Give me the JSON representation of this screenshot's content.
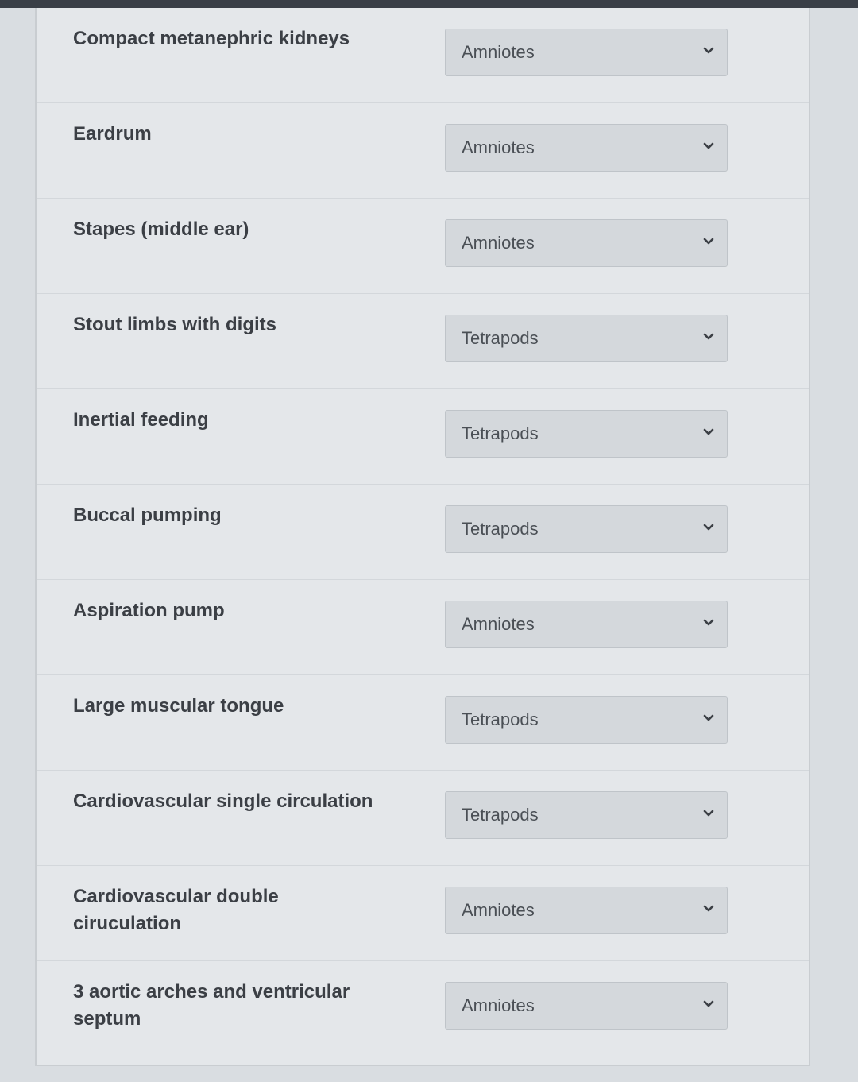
{
  "items": [
    {
      "label": "Compact metanephric kidneys",
      "selected": "Amniotes"
    },
    {
      "label": "Eardrum",
      "selected": "Amniotes"
    },
    {
      "label": "Stapes (middle ear)",
      "selected": "Amniotes"
    },
    {
      "label": "Stout limbs with digits",
      "selected": "Tetrapods"
    },
    {
      "label": "Inertial feeding",
      "selected": "Tetrapods"
    },
    {
      "label": "Buccal pumping",
      "selected": "Tetrapods"
    },
    {
      "label": "Aspiration pump",
      "selected": "Amniotes"
    },
    {
      "label": "Large muscular tongue",
      "selected": "Tetrapods"
    },
    {
      "label": "Cardiovascular single circulation",
      "selected": "Tetrapods"
    },
    {
      "label": "Cardiovascular double ciruculation",
      "selected": "Amniotes"
    },
    {
      "label": "3 aortic arches and ventricular septum",
      "selected": "Amniotes"
    }
  ],
  "icons": {
    "dropdown": "chevron-down-icon"
  },
  "colors": {
    "panel": "#e4e7ea",
    "select_bg": "#d4d8dc",
    "text": "#3b3f45"
  }
}
